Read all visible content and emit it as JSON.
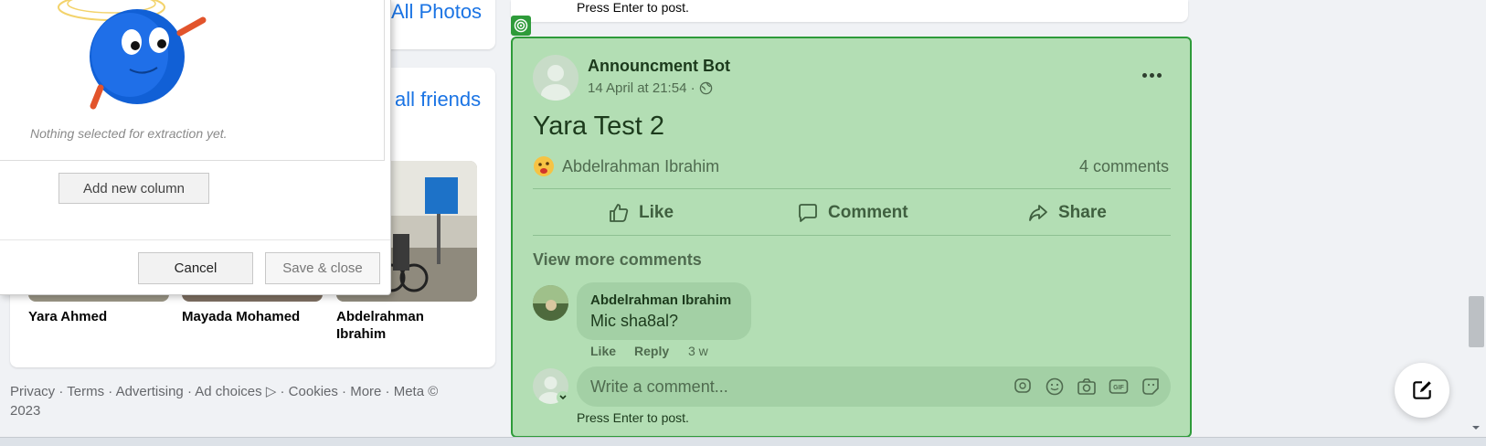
{
  "sidebar": {
    "photos_link": "All Photos",
    "friends_link": "all friends",
    "friends": [
      {
        "name": "Yara Ahmed"
      },
      {
        "name": "Mayada Mohamed"
      },
      {
        "name": "Abdelrahman Ibrahim"
      }
    ],
    "footer": "Privacy · Terms · Advertising · Ad choices ▷ · Cookies · More · Meta © 2023"
  },
  "dialog": {
    "empty_message": "Nothing selected for extraction yet.",
    "add_column_label": "Add new column",
    "cancel_label": "Cancel",
    "save_close_label": "Save & close"
  },
  "previous_post": {
    "hint": "Press Enter to post."
  },
  "post": {
    "author": "Announcment Bot",
    "timestamp": "14 April at 21:54 ·",
    "title": "Yara Test 2",
    "reactor": "Abdelrahman Ibrahim",
    "comments_count": "4 comments",
    "actions": {
      "like": "Like",
      "comment": "Comment",
      "share": "Share"
    },
    "view_more": "View more comments",
    "comment": {
      "author": "Abdelrahman Ibrahim",
      "text": "Mic sha8al?",
      "like": "Like",
      "reply": "Reply",
      "age": "3 w"
    },
    "composer": {
      "placeholder": "Write a comment...",
      "hint": "Press Enter to post."
    }
  },
  "colors": {
    "highlight_fill": "#b3deb4",
    "highlight_border": "#2e9b3a",
    "link": "#1b74e4"
  }
}
